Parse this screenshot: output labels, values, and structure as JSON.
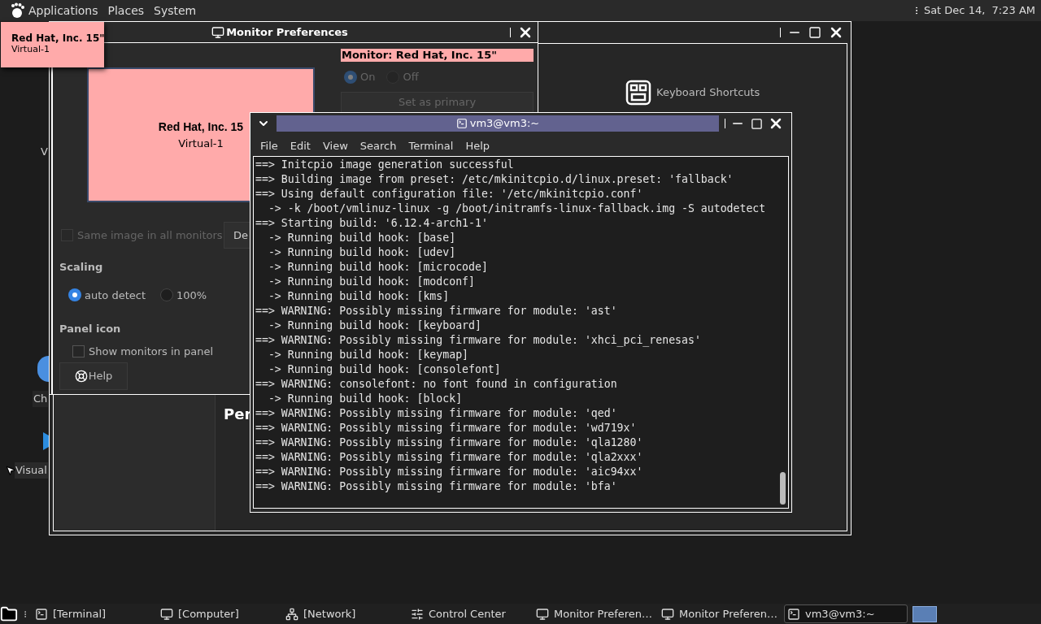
{
  "top_bar": {
    "menus": [
      "Applications",
      "Places",
      "System"
    ],
    "clock": "Sat Dec 14,  7:23 AM"
  },
  "desktop_icons": [
    {
      "label": "V"
    },
    {
      "label": "Ch"
    },
    {
      "label": "Visual"
    }
  ],
  "control_center": {
    "shortcut": "Keyboard Shortcuts",
    "section_heading": "Per"
  },
  "monitor_preferences": {
    "title": "Monitor Preferences",
    "monitor_preview": {
      "name": "Red Hat, Inc. 15",
      "output": "Virtual-1"
    },
    "monitor_label": "Monitor: Red Hat, Inc. 15\"",
    "power": {
      "disabled": true,
      "options": [
        {
          "label": "On",
          "selected": true
        },
        {
          "label": "Off",
          "selected": false
        }
      ]
    },
    "primary_button": {
      "label": "Set as primary",
      "disabled": true
    },
    "mirror": {
      "label": "Same image in all monitors",
      "checked": false,
      "disabled": true
    },
    "detect_button": "De",
    "scaling": {
      "heading": "Scaling",
      "options": [
        {
          "label": "auto detect",
          "selected": true
        },
        {
          "label": "100%",
          "selected": false
        }
      ]
    },
    "panel_icon": {
      "heading": "Panel icon",
      "checkbox": {
        "label": "Show monitors in panel",
        "checked": false
      }
    },
    "help_button": "Help"
  },
  "tooltip": {
    "name": "Red Hat, Inc. 15\"",
    "output": "Virtual-1"
  },
  "terminal": {
    "title": "vm3@vm3:~",
    "menu": [
      "File",
      "Edit",
      "View",
      "Search",
      "Terminal",
      "Help"
    ],
    "lines": [
      "==> Initcpio image generation successful",
      "==> Building image from preset: /etc/mkinitcpio.d/linux.preset: 'fallback'",
      "==> Using default configuration file: '/etc/mkinitcpio.conf'",
      "  -> -k /boot/vmlinuz-linux -g /boot/initramfs-linux-fallback.img -S autodetect",
      "==> Starting build: '6.12.4-arch1-1'",
      "  -> Running build hook: [base]",
      "  -> Running build hook: [udev]",
      "  -> Running build hook: [microcode]",
      "  -> Running build hook: [modconf]",
      "  -> Running build hook: [kms]",
      "==> WARNING: Possibly missing firmware for module: 'ast'",
      "  -> Running build hook: [keyboard]",
      "==> WARNING: Possibly missing firmware for module: 'xhci_pci_renesas'",
      "  -> Running build hook: [keymap]",
      "  -> Running build hook: [consolefont]",
      "==> WARNING: consolefont: no font found in configuration",
      "  -> Running build hook: [block]",
      "==> WARNING: Possibly missing firmware for module: 'qed'",
      "==> WARNING: Possibly missing firmware for module: 'wd719x'",
      "==> WARNING: Possibly missing firmware for module: 'qla1280'",
      "==> WARNING: Possibly missing firmware for module: 'qla2xxx'",
      "==> WARNING: Possibly missing firmware for module: 'aic94xx'",
      "==> WARNING: Possibly missing firmware for module: 'bfa'"
    ]
  },
  "taskbar": {
    "items": [
      {
        "kind": "terminal",
        "label": "[Terminal]",
        "selected": false
      },
      {
        "kind": "computer",
        "label": "[Computer]",
        "selected": false
      },
      {
        "kind": "network",
        "label": "[Network]",
        "selected": false
      },
      {
        "kind": "control",
        "label": "Control Center",
        "selected": false
      },
      {
        "kind": "monitor",
        "label": "Monitor Preferen…",
        "selected": false
      },
      {
        "kind": "monitor",
        "label": "Monitor Preferen…",
        "selected": false
      },
      {
        "kind": "terminal",
        "label": "vm3@vm3:~",
        "selected": true
      }
    ]
  }
}
